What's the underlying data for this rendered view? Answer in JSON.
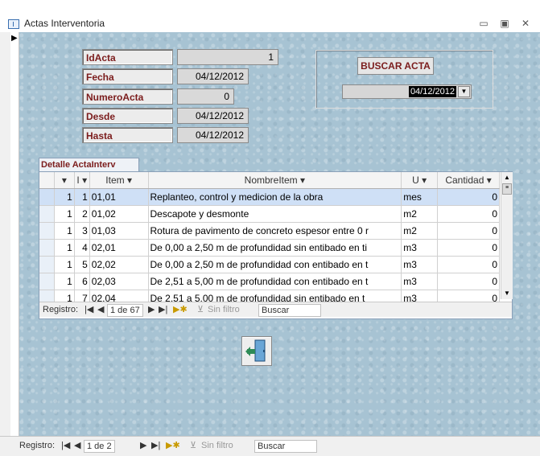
{
  "window": {
    "title": "Actas Interventoria"
  },
  "form": {
    "fields": [
      {
        "label": "IdActa",
        "value": "1"
      },
      {
        "label": "Fecha",
        "value": "04/12/2012"
      },
      {
        "label": "NumeroActa",
        "value": "0"
      },
      {
        "label": "Desde",
        "value": "04/12/2012"
      },
      {
        "label": "Hasta",
        "value": "04/12/2012"
      }
    ],
    "search_button": "BUSCAR ACTA",
    "search_combo_value": "04/12/2012"
  },
  "subform": {
    "tab_label": "Detalle ActaInterv",
    "columns": [
      "I",
      "Item",
      "NombreItem",
      "U",
      "Cantidad"
    ],
    "rows": [
      {
        "c1": "1",
        "c2": "1",
        "item": "01,01",
        "nombre": "Replanteo, control y medicion de la obra",
        "u": "mes",
        "cant": "0"
      },
      {
        "c1": "1",
        "c2": "2",
        "item": "01,02",
        "nombre": "Descapote y desmonte",
        "u": "m2",
        "cant": "0"
      },
      {
        "c1": "1",
        "c2": "3",
        "item": "01,03",
        "nombre": "Rotura de pavimento de concreto espesor entre 0 r",
        "u": "m2",
        "cant": "0"
      },
      {
        "c1": "1",
        "c2": "4",
        "item": "02,01",
        "nombre": "De 0,00 a 2,50 m de profundidad sin entibado en ti",
        "u": "m3",
        "cant": "0"
      },
      {
        "c1": "1",
        "c2": "5",
        "item": "02,02",
        "nombre": "De 0,00 a 2,50 m de profundidad con entibado en t",
        "u": "m3",
        "cant": "0"
      },
      {
        "c1": "1",
        "c2": "6",
        "item": "02,03",
        "nombre": "De 2,51 a 5,00 m de profundidad con entibado en t",
        "u": "m3",
        "cant": "0"
      },
      {
        "c1": "1",
        "c2": "7",
        "item": "02,04",
        "nombre": "De 2,51 a 5,00 m de profundidad sin entibado  en t",
        "u": "m3",
        "cant": "0"
      }
    ],
    "nav": {
      "label": "Registro:",
      "current": "1 de 67",
      "filter": "Sin filtro",
      "search": "Buscar"
    }
  },
  "main_nav": {
    "label": "Registro:",
    "current": "1 de 2",
    "filter": "Sin filtro",
    "search": "Buscar"
  }
}
